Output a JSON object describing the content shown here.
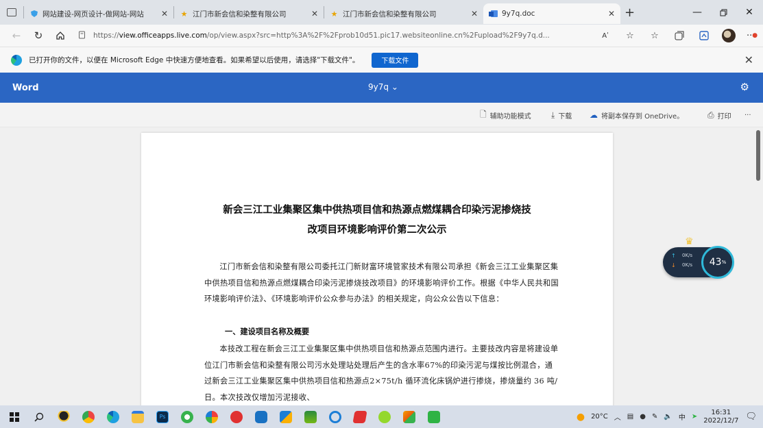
{
  "browser": {
    "tabs": [
      {
        "favicon": "shield-icon",
        "title": "网站建设-网页设计-做网站-网站",
        "active": false
      },
      {
        "favicon": "star-icon",
        "title": "江门市新会信和染整有限公司",
        "active": false
      },
      {
        "favicon": "star-icon",
        "title": "江门市新会信和染整有限公司",
        "active": false
      },
      {
        "favicon": "word-icon",
        "title": "9y7q.doc",
        "active": true
      }
    ],
    "new_tab": "+",
    "address_bar": {
      "prefix": "https://",
      "domain": "view.officeapps.live.com",
      "rest": "/op/view.aspx?src=http%3A%2F%2Fprob10d51.pic17.websiteonline.cn%2Fupload%2F9y7q.d...",
      "read_aloud_label": "Aʹ"
    },
    "infobar": {
      "text": "已打开你的文件，以便在 Microsoft Edge 中快速方便地查看。如果希望以后使用，请选择\"下载文件\"。",
      "download_button": "下载文件"
    }
  },
  "word": {
    "brand": "Word",
    "doc_name": "9y7q",
    "commands": {
      "accessibility": "辅助功能模式",
      "download": "下载",
      "save_onedrive": "将副本保存到 OneDrive。",
      "print": "打印",
      "more": "···"
    }
  },
  "document": {
    "title_line1": "新会三江工业集聚区集中供热项目信和热源点燃煤耦合印染污泥掺烧技",
    "title_line2": "改项目环境影响评价第二次公示",
    "para1": "江门市新会信和染整有限公司委托江门新财富环境管家技术有限公司承担《新会三江工业集聚区集中供热项目信和热源点燃煤耦合印染污泥掺烧技改项目》的环境影响评价工作。根据《中华人民共和国环境影响评价法》、《环境影响评价公众参与办法》的相关规定，向公众公告以下信息：",
    "heading1": "一、建设项目名称及概要",
    "para2": "本技改工程在新会三江工业集聚区集中供热项目信和热源点范围内进行。主要技改内容是将建设单位江门市新会信和染整有限公司污水处理站处理后产生的含水率67%的印染污泥与煤按比例混合，通过新会三江工业集聚区集中供热项目信和热源点2×75t/h 循环流化床锅炉进行掺烧，掺烧量约 36 吨/日。本次技改仅增加污泥接收、"
  },
  "speed_widget": {
    "up_rate": "0K/s",
    "down_rate": "0K/s",
    "percent": "43",
    "percent_unit": "%"
  },
  "taskbar": {
    "weather": "20°C",
    "ime1": "中",
    "time": "16:31",
    "date": "2022/12/7"
  },
  "colors": {
    "word_blue": "#2b66c3",
    "edge_download_blue": "#1066cf"
  }
}
